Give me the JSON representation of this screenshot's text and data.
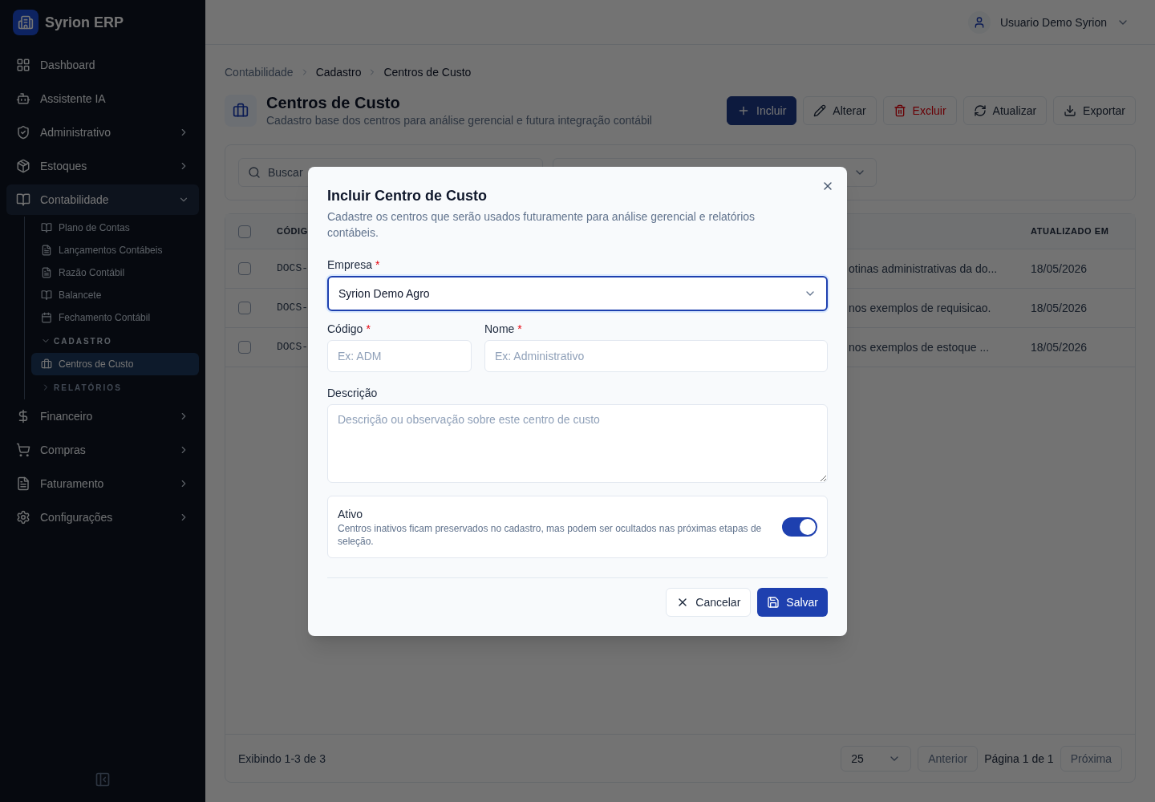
{
  "app": {
    "name": "Syrion ERP"
  },
  "sidebar": {
    "items": [
      {
        "label": "Dashboard",
        "kind": "link"
      },
      {
        "label": "Assistente IA",
        "kind": "link"
      },
      {
        "label": "Administrativo",
        "kind": "group",
        "expanded": false
      },
      {
        "label": "Estoques",
        "kind": "group",
        "expanded": false
      },
      {
        "label": "Contabilidade",
        "kind": "group",
        "expanded": true,
        "children": [
          {
            "label": "Plano de Contas",
            "kind": "link",
            "selected": false
          },
          {
            "label": "Lançamentos Contábeis",
            "kind": "link",
            "selected": false
          },
          {
            "label": "Razão Contábil",
            "kind": "link",
            "selected": false
          },
          {
            "label": "Balancete",
            "kind": "link",
            "selected": false
          },
          {
            "label": "Fechamento Contábil",
            "kind": "link",
            "selected": false
          },
          {
            "label": "CADASTRO",
            "kind": "section",
            "expanded": true,
            "children": [
              {
                "label": "Centros de Custo",
                "kind": "link",
                "selected": true
              }
            ]
          },
          {
            "label": "RELATÓRIOS",
            "kind": "section",
            "expanded": false
          }
        ]
      },
      {
        "label": "Financeiro",
        "kind": "group",
        "expanded": false
      },
      {
        "label": "Compras",
        "kind": "group",
        "expanded": false
      },
      {
        "label": "Faturamento",
        "kind": "group",
        "expanded": false
      },
      {
        "label": "Configurações",
        "kind": "group",
        "expanded": false
      }
    ]
  },
  "header": {
    "user": "Usuario Demo Syrion"
  },
  "breadcrumb": [
    "Contabilidade",
    "Cadastro",
    "Centros de Custo"
  ],
  "page": {
    "title": "Centros de Custo",
    "subtitle": "Cadastro base dos centros para análise gerencial e futura integração contábil"
  },
  "toolbar": [
    {
      "label": "Incluir",
      "kind": "primary"
    },
    {
      "label": "Alterar",
      "kind": "default"
    },
    {
      "label": "Excluir",
      "kind": "danger"
    },
    {
      "label": "Atualizar",
      "kind": "default"
    },
    {
      "label": "Exportar",
      "kind": "default"
    }
  ],
  "filters": {
    "search_placeholder": "Buscar"
  },
  "table": {
    "all_checked": false,
    "columns": [
      "CÓDIG",
      "ATUALIZADO EM"
    ],
    "rows": [
      {
        "checked": false,
        "code": "DOCS-",
        "description": "otinas administrativas da do...",
        "updated": "18/05/2026"
      },
      {
        "checked": false,
        "code": "DOCS-",
        "description": "nos exemplos de requisicao.",
        "updated": "18/05/2026"
      },
      {
        "checked": false,
        "code": "DOCS-",
        "description": "nos exemplos de estoque ...",
        "updated": "18/05/2026"
      }
    ]
  },
  "pagination": {
    "summary": "Exibindo 1-3 de 3",
    "page_size": "25",
    "previous": {
      "label": "Anterior",
      "disabled": true
    },
    "page": "Página 1 de 1",
    "next": {
      "label": "Próxima",
      "disabled": true
    }
  },
  "dialog": {
    "title": "Incluir Centro de Custo",
    "description": "Cadastre os centros que serão usados futuramente para análise gerencial e relatórios contábeis.",
    "empresa": {
      "label": "Empresa",
      "required_mark": "*",
      "value": "Syrion Demo Agro",
      "focused": true
    },
    "codigo": {
      "label": "Código",
      "required_mark": "*",
      "placeholder": "Ex: ADM"
    },
    "nome": {
      "label": "Nome",
      "required_mark": "*",
      "placeholder": "Ex: Administrativo"
    },
    "descricao": {
      "label": "Descrição",
      "placeholder": "Descrição ou observação sobre este centro de custo"
    },
    "ativo": {
      "label": "Ativo",
      "hint": "Centros inativos ficam preservados no cadastro, mas podem ser ocultados nas próximas etapas de seleção.",
      "on": true
    },
    "buttons": [
      {
        "label": "Cancelar",
        "kind": "secondary"
      },
      {
        "label": "Salvar",
        "kind": "primary"
      }
    ]
  }
}
